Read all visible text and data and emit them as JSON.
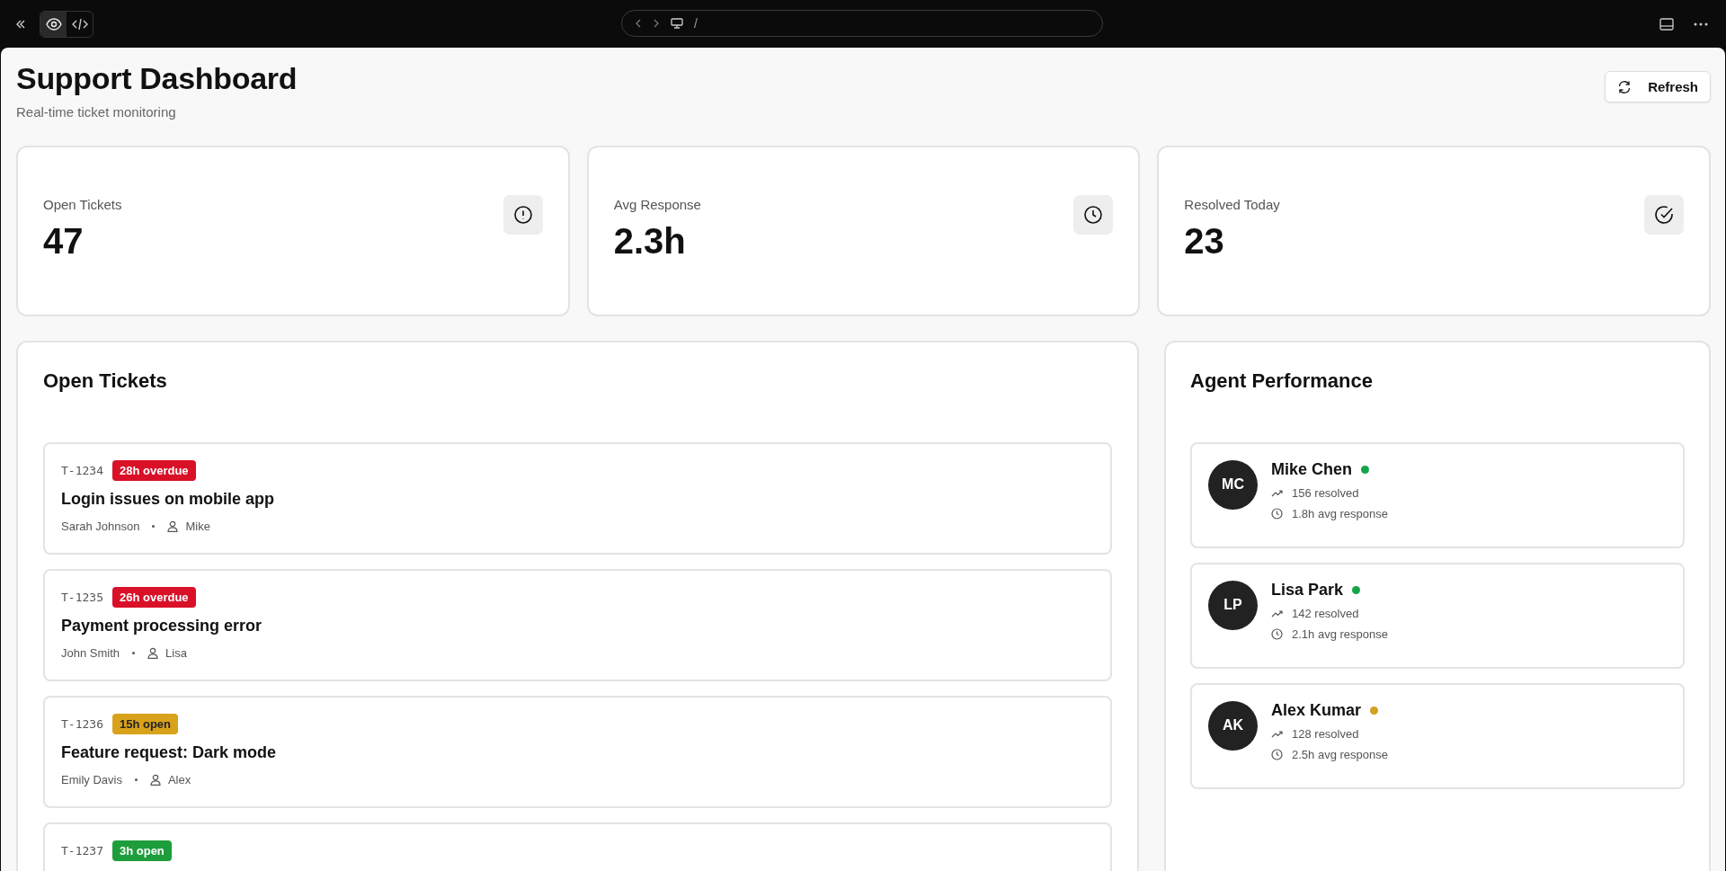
{
  "browser_bar": {
    "preview_selected": true,
    "url": "/"
  },
  "header": {
    "title": "Support Dashboard",
    "subtitle": "Real-time ticket monitoring",
    "refresh_button": "Refresh"
  },
  "stats": [
    {
      "label": "Open Tickets",
      "value": "47",
      "kind": "alert"
    },
    {
      "label": "Avg Response",
      "value": "2.3h",
      "kind": "clock"
    },
    {
      "label": "Resolved Today",
      "value": "23",
      "kind": "check"
    }
  ],
  "tickets_panel": {
    "title": "Open Tickets",
    "tickets": [
      {
        "id": "T-1234",
        "badge": "28h overdue",
        "kind": "overdue",
        "title": "Login issues on mobile app",
        "customer": "Sarah Johnson",
        "assignee": "Mike"
      },
      {
        "id": "T-1235",
        "badge": "26h overdue",
        "kind": "overdue",
        "title": "Payment processing error",
        "customer": "John Smith",
        "assignee": "Lisa"
      },
      {
        "id": "T-1236",
        "badge": "15h open",
        "kind": "aging",
        "title": "Feature request: Dark mode",
        "customer": "Emily Davis",
        "assignee": "Alex"
      },
      {
        "id": "T-1237",
        "badge": "3h open",
        "kind": "fresh"
      }
    ]
  },
  "agents_panel": {
    "title": "Agent Performance",
    "agents": [
      {
        "initials": "MC",
        "name": "Mike Chen",
        "color": "#16a34a",
        "resolved": "156 resolved",
        "response": "1.8h avg response"
      },
      {
        "initials": "LP",
        "name": "Lisa Park",
        "color": "#16a34a",
        "resolved": "142 resolved",
        "response": "2.1h avg response"
      },
      {
        "initials": "AK",
        "name": "Alex Kumar",
        "color": "#d4a020",
        "resolved": "128 resolved",
        "response": "2.5h avg response"
      }
    ]
  }
}
